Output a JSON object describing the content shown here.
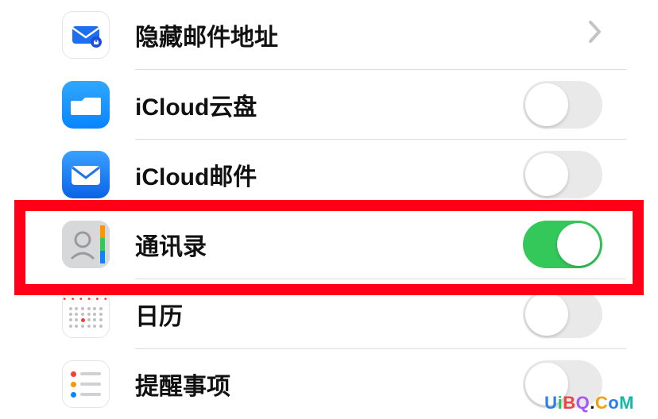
{
  "rows": [
    {
      "key": "hide_mail",
      "label": "隐藏邮件地址",
      "icon": "hide-mail-icon",
      "control": "chevron"
    },
    {
      "key": "icloud_drive",
      "label": "iCloud云盘",
      "icon": "drive-icon",
      "control": "toggle",
      "on": false
    },
    {
      "key": "icloud_mail",
      "label": "iCloud邮件",
      "icon": "mail-icon",
      "control": "toggle",
      "on": false
    },
    {
      "key": "contacts",
      "label": "通讯录",
      "icon": "contacts-icon",
      "control": "toggle",
      "on": true
    },
    {
      "key": "calendar",
      "label": "日历",
      "icon": "calendar-icon",
      "control": "toggle",
      "on": false
    },
    {
      "key": "reminders",
      "label": "提醒事项",
      "icon": "reminders-icon",
      "control": "toggle",
      "on": false
    }
  ],
  "highlight_row_key": "contacts",
  "colors": {
    "highlight_border": "#ff0018",
    "toggle_on": "#34c759",
    "toggle_off": "#e9e9ea"
  },
  "watermark": "UiBQ.CoM"
}
